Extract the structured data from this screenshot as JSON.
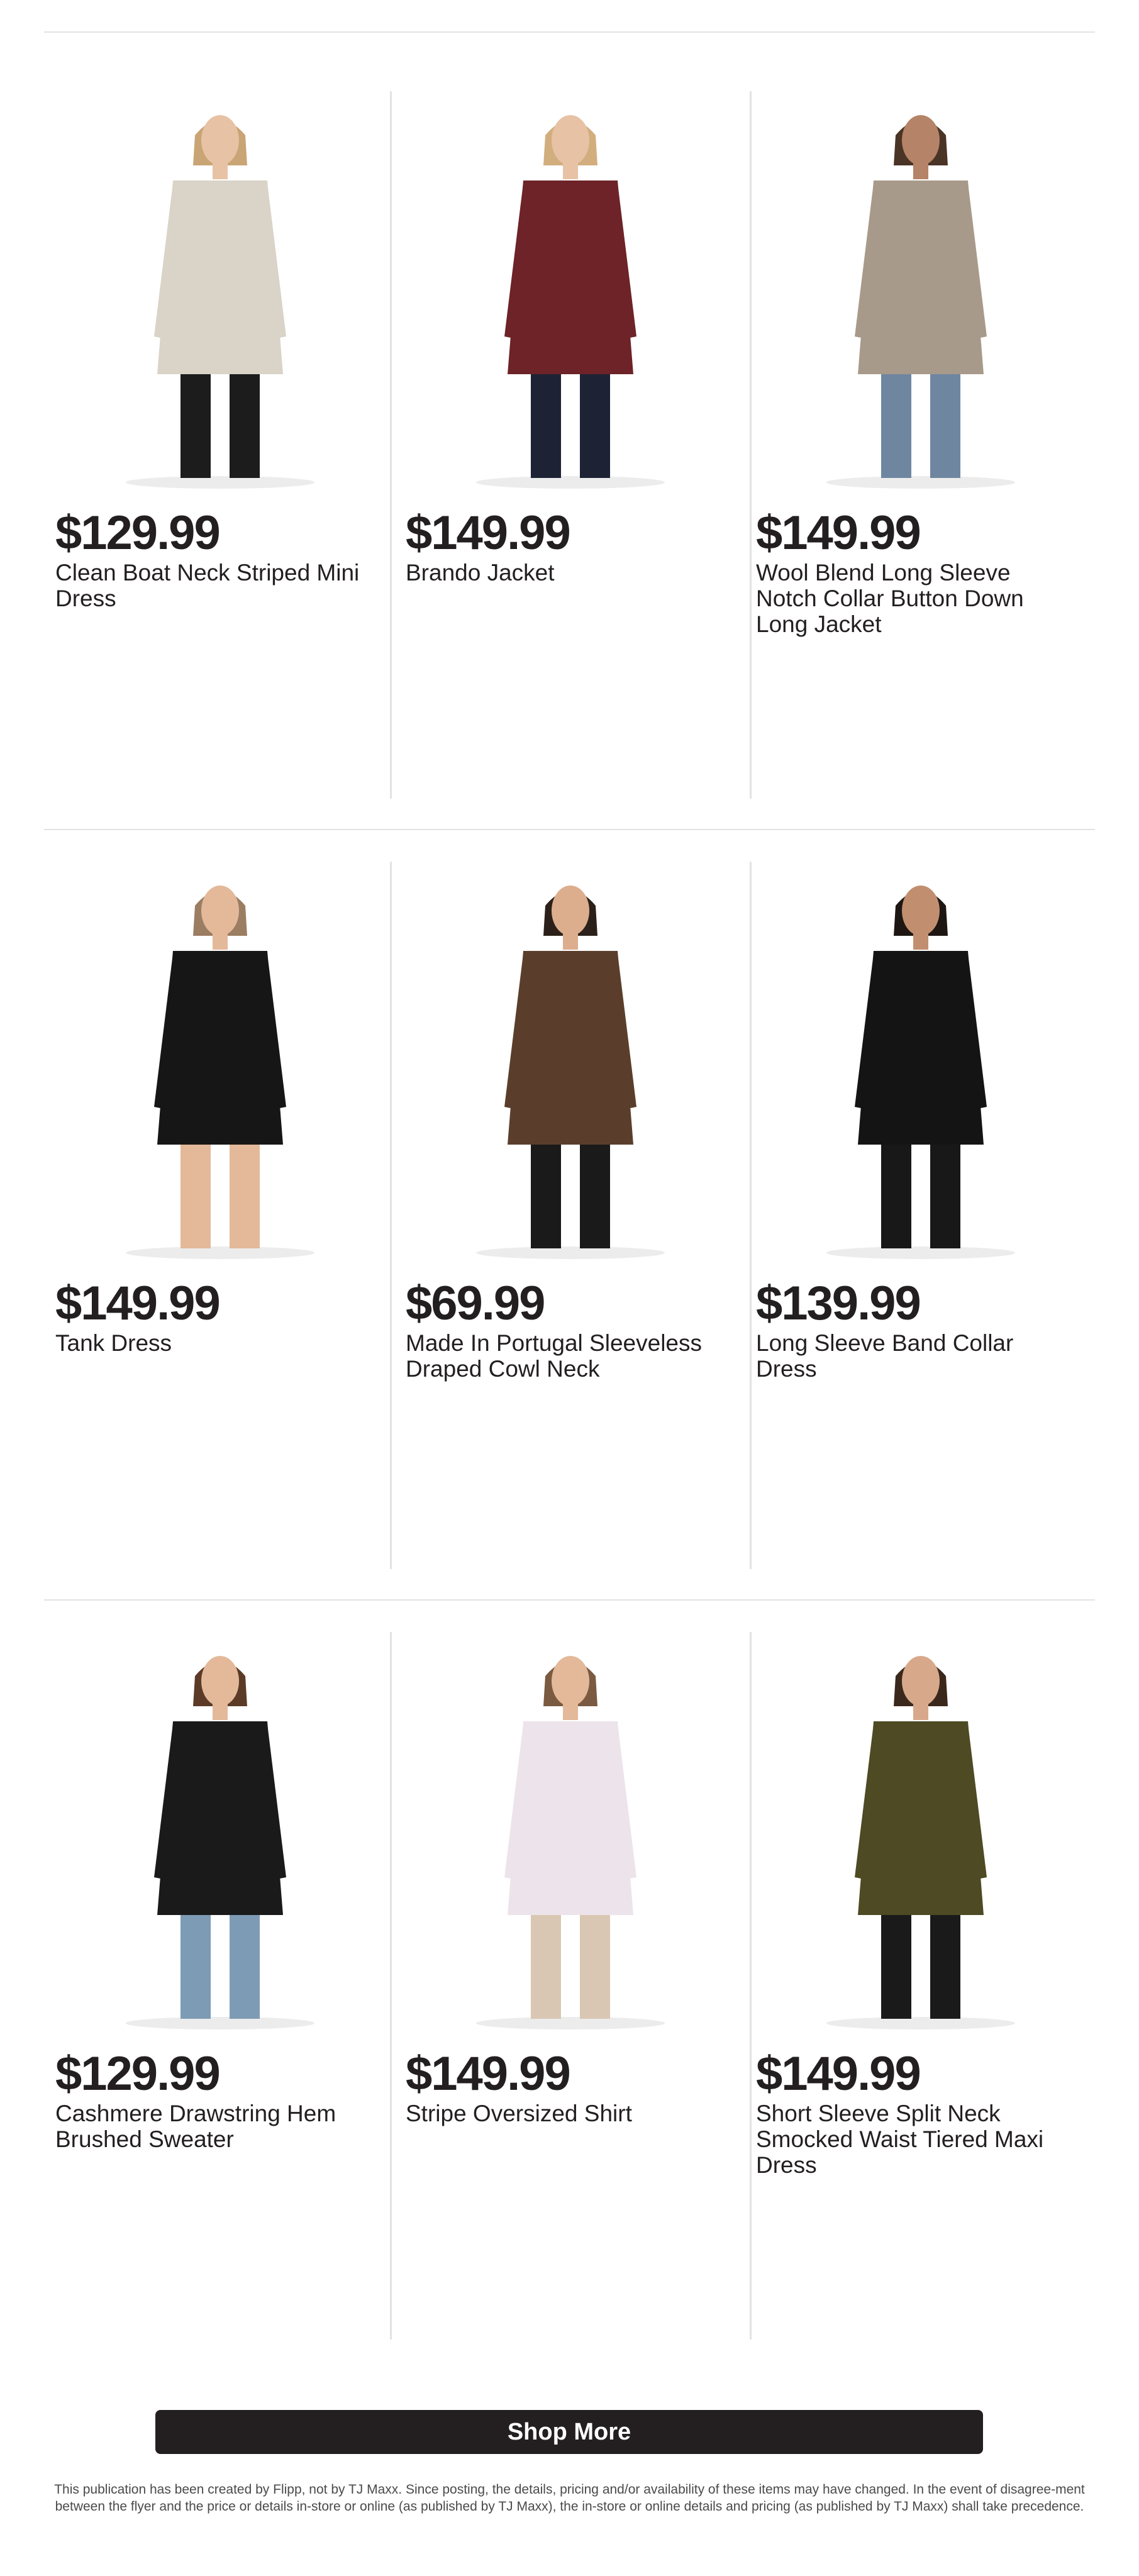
{
  "products": [
    {
      "price": "$129.99",
      "name": "Clean Boat Neck Striped Mini Dress",
      "image": "woman-striped-mini-dress-photo",
      "colors": {
        "garment": "#d9d3c8",
        "legs": "#1c1c1c",
        "skin": "#e7c2a5",
        "hair": "#c9a474"
      }
    },
    {
      "price": "$149.99",
      "name": "Brando Jacket",
      "image": "woman-burgundy-belted-jacket-photo",
      "colors": {
        "garment": "#6d2327",
        "legs": "#1d2335",
        "skin": "#e7c2a5",
        "hair": "#d2ae7e"
      }
    },
    {
      "price": "$149.99",
      "name": "Wool Blend Long Sleeve Notch Collar Button Down Long Jacket",
      "image": "woman-taupe-long-coat-photo",
      "colors": {
        "garment": "#a89a8a",
        "legs": "#6f86a1",
        "skin": "#b58367",
        "hair": "#4a3426"
      }
    },
    {
      "price": "$149.99",
      "name": "Tank Dress",
      "image": "woman-black-tank-dress-photo",
      "colors": {
        "garment": "#161616",
        "legs": "#e3b99a",
        "skin": "#e3b99a",
        "hair": "#9b7d62"
      }
    },
    {
      "price": "$69.99",
      "name": "Made In Portugal Sleeveless Draped Cowl Neck",
      "image": "woman-brown-cowl-top-photo",
      "colors": {
        "garment": "#5a3e2b",
        "legs": "#1a1a1a",
        "skin": "#dcae8e",
        "hair": "#2c211a"
      }
    },
    {
      "price": "$139.99",
      "name": "Long Sleeve Band Collar Dress",
      "image": "woman-black-satin-dress-photo",
      "colors": {
        "garment": "#141414",
        "legs": "#181818",
        "skin": "#c18f70",
        "hair": "#1e1612"
      }
    },
    {
      "price": "$129.99",
      "name": "Cashmere Drawstring Hem Brushed Sweater",
      "image": "woman-black-sweater-photo",
      "colors": {
        "garment": "#1a1a1a",
        "legs": "#7d9bb4",
        "skin": "#e3b99a",
        "hair": "#5b3b27"
      }
    },
    {
      "price": "$149.99",
      "name": "Stripe Oversized Shirt",
      "image": "woman-striped-shirt-photo",
      "colors": {
        "garment": "#ece4ea",
        "legs": "#d9c7b3",
        "skin": "#e3b99a",
        "hair": "#7a5a40"
      }
    },
    {
      "price": "$149.99",
      "name": "Short Sleeve Split Neck Smocked Waist Tiered Maxi Dress",
      "image": "woman-olive-floral-maxi-dress-photo",
      "colors": {
        "garment": "#4d4a24",
        "legs": "#1a1a1a",
        "skin": "#d7a98a",
        "hair": "#3b281c"
      }
    }
  ],
  "shop_more": "Shop More",
  "disclaimer": "This publication has been created by Flipp, not by TJ Maxx. Since posting, the details, pricing and/or availability of these items may have changed. In the event of disagree-ment between the flyer and the price or details in-store or online (as published by TJ Maxx), the in-store or online details and pricing (as published by TJ Maxx) shall take precedence.",
  "colors": {
    "divider": "#e4e2e2",
    "button_bg": "#231f20",
    "text": "#231f20"
  }
}
